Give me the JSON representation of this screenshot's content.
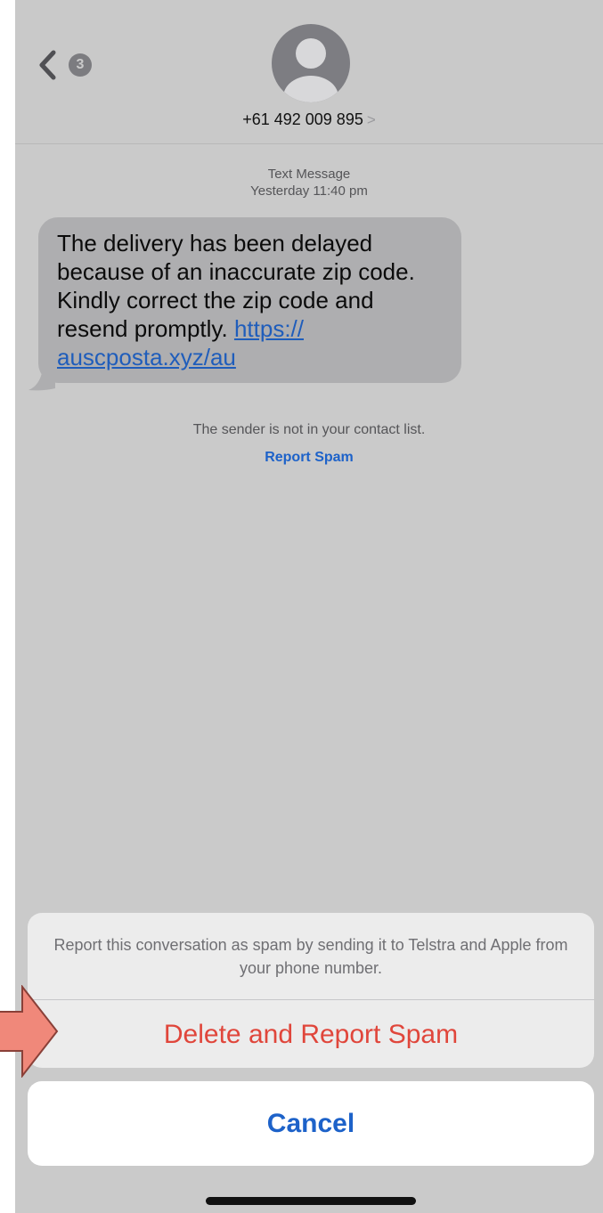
{
  "header": {
    "back_badge_count": "3",
    "contact_number": "+61 492 009 895",
    "contact_chevron": ">"
  },
  "conversation": {
    "message_type": "Text Message",
    "timestamp": "Yesterday 11:40 pm",
    "message_text": "The delivery has been delayed because of an inaccurate zip code. Kindly correct the zip code and resend promptly.",
    "message_link": "https://auscposta.xyz/au",
    "link_part1": "https://",
    "link_part2": "auscposta.xyz/au",
    "sender_notice": "The sender is not in your contact list.",
    "report_spam_link": "Report Spam"
  },
  "action_sheet": {
    "message": "Report this conversation as spam by sending it to Telstra and Apple from your phone number.",
    "delete_report_label": "Delete and Report Spam",
    "cancel_label": "Cancel"
  },
  "colors": {
    "destructive": "#e0463b",
    "link_blue": "#1d62c9",
    "arrow_fill": "#f0887a",
    "arrow_stroke": "#8a4038"
  },
  "icons": {
    "back": "chevron-left-icon",
    "avatar": "person-avatar-icon",
    "annotation": "pointer-arrow-icon"
  }
}
